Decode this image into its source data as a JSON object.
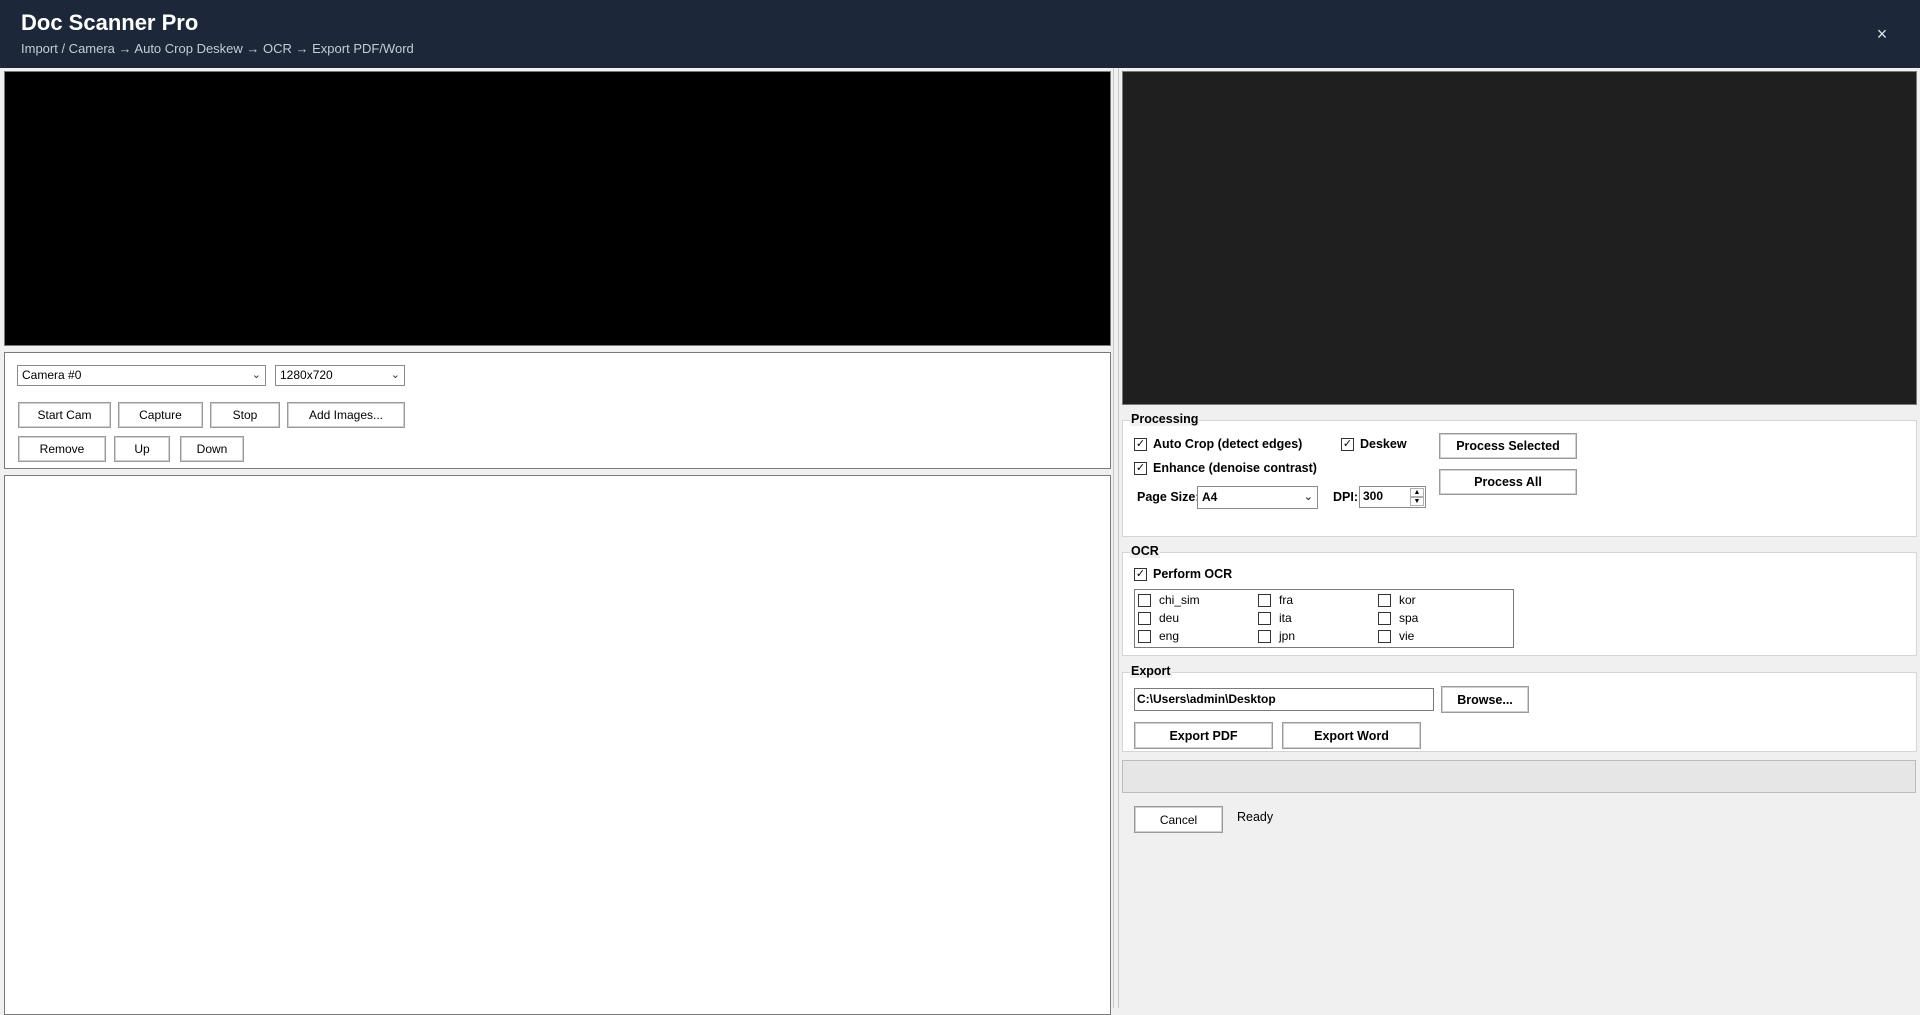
{
  "window": {
    "title": "Doc Scanner Pro",
    "subtitle": "Import / Camera → Auto Crop  Deskew → OCR → Export PDF/Word",
    "close_glyph": "×"
  },
  "camera": {
    "device_selected": "Camera #0",
    "resolution_selected": "1280x720",
    "buttons": {
      "start": "Start Cam",
      "capture": "Capture",
      "stop": "Stop",
      "add_images": "Add Images...",
      "remove": "Remove",
      "up": "Up",
      "down": "Down"
    }
  },
  "processing": {
    "group_label": "Processing",
    "auto_crop": {
      "label": "Auto Crop (detect edges)",
      "checked": true
    },
    "deskew": {
      "label": "Deskew",
      "checked": true
    },
    "enhance": {
      "label": "Enhance (denoise contrast)",
      "checked": true
    },
    "page_size_label": "Page Size:",
    "page_size_value": "A4",
    "dpi_label": "DPI:",
    "dpi_value": "300",
    "process_selected": "Process Selected",
    "process_all": "Process All"
  },
  "ocr": {
    "group_label": "OCR",
    "perform": {
      "label": "Perform OCR",
      "checked": true
    },
    "languages": [
      {
        "code": "chi_sim",
        "checked": false
      },
      {
        "code": "fra",
        "checked": false
      },
      {
        "code": "kor",
        "checked": false
      },
      {
        "code": "deu",
        "checked": false
      },
      {
        "code": "ita",
        "checked": false
      },
      {
        "code": "spa",
        "checked": false
      },
      {
        "code": "eng",
        "checked": false
      },
      {
        "code": "jpn",
        "checked": false
      },
      {
        "code": "vie",
        "checked": false
      }
    ]
  },
  "export": {
    "group_label": "Export",
    "path": "C:\\Users\\admin\\Desktop",
    "browse": "Browse...",
    "export_pdf": "Export PDF",
    "export_word": "Export Word"
  },
  "progress": {
    "fraction": 0
  },
  "footer": {
    "cancel": "Cancel",
    "status": "Ready"
  },
  "colors": {
    "titlebar": "#1c2739",
    "camera_preview": "#000000",
    "processed_preview": "#1f1f1f",
    "progress_fill": "#06b025"
  },
  "icons": {
    "close": "close-icon",
    "dropdown": "chevron-down-icon",
    "spinner_up": "spinner-up-icon",
    "spinner_down": "spinner-down-icon",
    "check": "checkmark-icon"
  }
}
